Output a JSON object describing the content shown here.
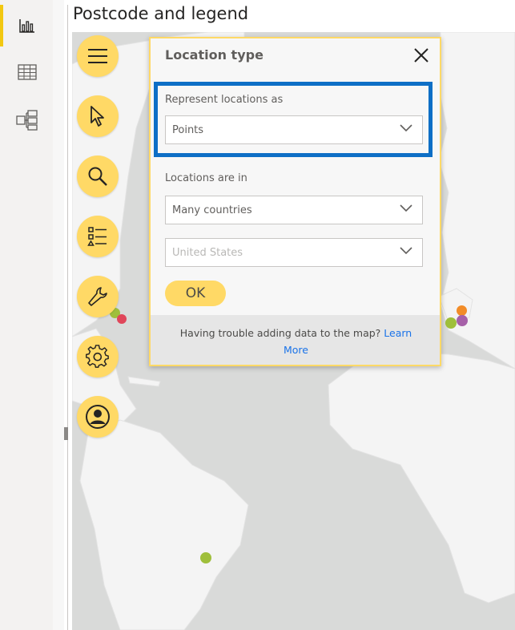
{
  "visual": {
    "title": "Postcode and legend"
  },
  "left_rail": {
    "items": [
      {
        "name": "report-view",
        "icon": "bar-chart-icon",
        "active": true
      },
      {
        "name": "data-view",
        "icon": "table-icon",
        "active": false
      },
      {
        "name": "model-view",
        "icon": "model-icon",
        "active": false
      }
    ]
  },
  "map_toolbar": {
    "buttons": [
      {
        "icon": "hamburger-menu-icon"
      },
      {
        "icon": "pointer-cursor-icon"
      },
      {
        "icon": "search-icon"
      },
      {
        "icon": "legend-list-icon"
      },
      {
        "icon": "wrench-icon"
      },
      {
        "icon": "gear-icon"
      },
      {
        "icon": "user-profile-icon"
      }
    ]
  },
  "dialog": {
    "title": "Location type",
    "represent_label": "Represent locations as",
    "represent_value": "Points",
    "locations_label": "Locations are in",
    "locations_value": "Many countries",
    "country_value": "United States",
    "ok_label": "OK",
    "help_text": "Having trouble adding data to the map?",
    "help_link_1": "Learn",
    "help_link_2": "More"
  },
  "colors": {
    "accent_yellow": "#ffd966",
    "highlight_blue": "#0e6fc6",
    "point_green": "#9fbf3b",
    "point_orange": "#f28c28",
    "point_purple": "#a660a8",
    "point_red": "#e0465a"
  }
}
